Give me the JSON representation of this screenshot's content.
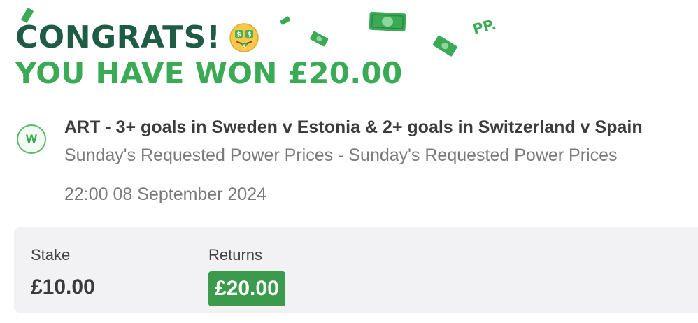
{
  "header": {
    "congrats": "CONGRATS!",
    "won": "YOU HAVE WON £20.00",
    "emoji": "money-mouth-face",
    "confetti_text": "PP."
  },
  "bet": {
    "status_letter": "W",
    "title": "ART - 3+ goals in Sweden v Estonia & 2+ goals in Switzerland v Spain",
    "subtitle": "Sunday's Requested Power Prices - Sunday's Requested Power Prices",
    "datetime": "22:00 08 September 2024"
  },
  "summary": {
    "stake_label": "Stake",
    "stake_value": "£10.00",
    "returns_label": "Returns",
    "returns_value": "£20.00"
  },
  "colors": {
    "dark_green": "#1f5c45",
    "accent_green": "#3aaa55",
    "returns_bg": "#3c9a4c",
    "panel_bg": "#f2f2f4"
  }
}
